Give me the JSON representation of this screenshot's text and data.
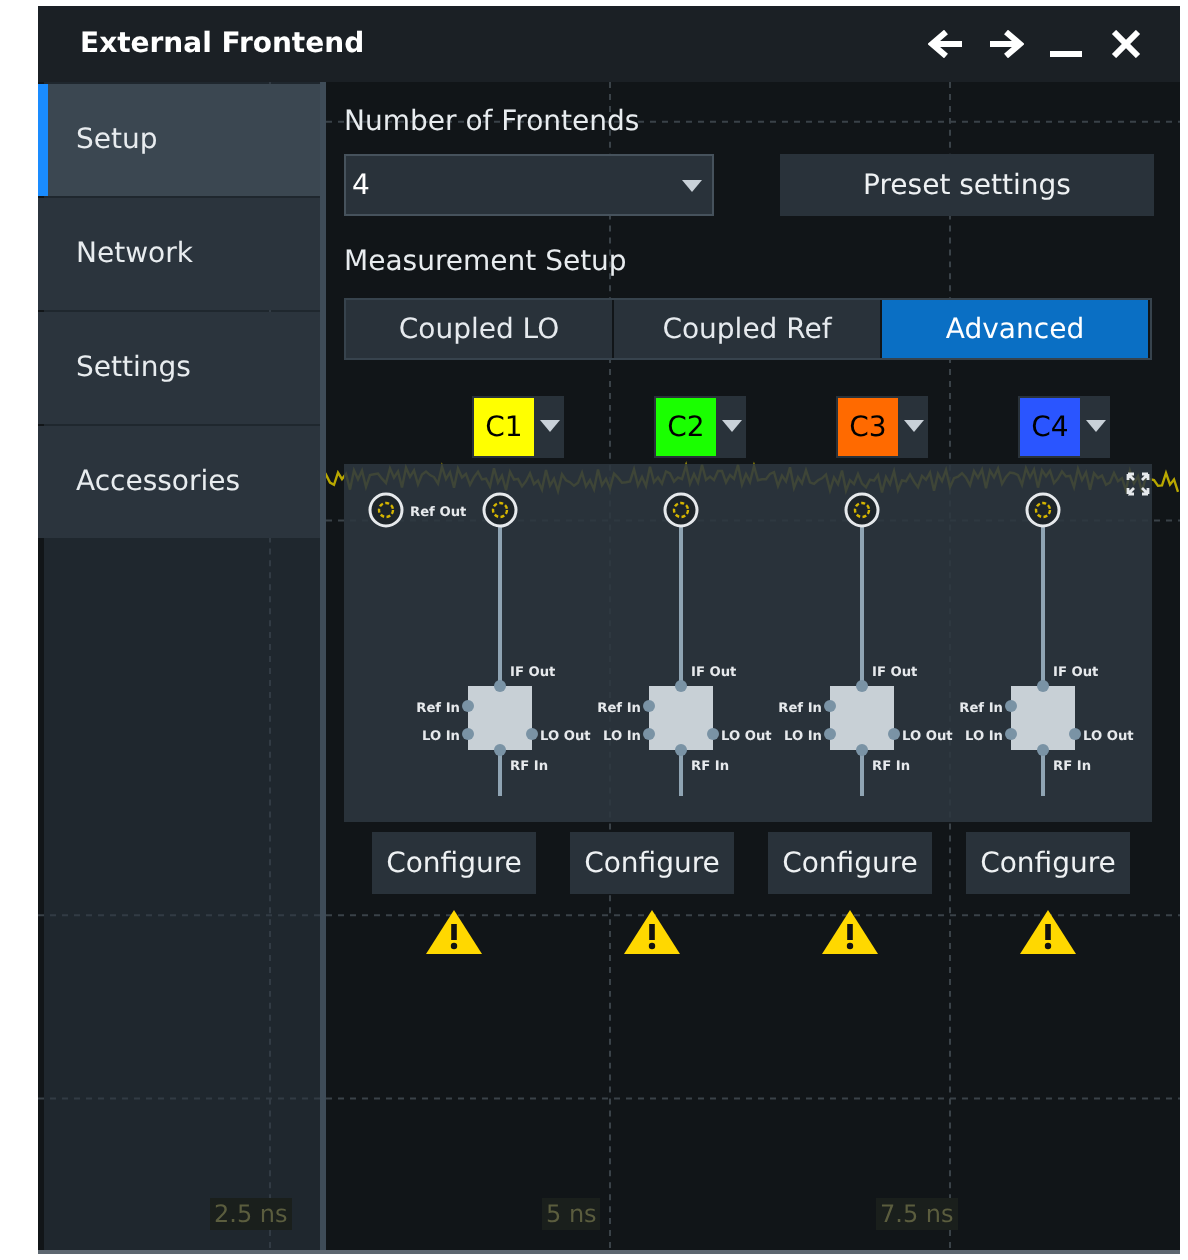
{
  "window": {
    "title": "External Frontend"
  },
  "sidebar": {
    "items": [
      {
        "label": "Setup",
        "selected": true
      },
      {
        "label": "Network",
        "selected": false
      },
      {
        "label": "Settings",
        "selected": false
      },
      {
        "label": "Accessories",
        "selected": false
      }
    ]
  },
  "frontends": {
    "label": "Number of Frontends",
    "value": "4"
  },
  "preset_button": "Preset settings",
  "measurement_setup": {
    "label": "Measurement Setup",
    "options": [
      {
        "label": "Coupled LO",
        "selected": false
      },
      {
        "label": "Coupled Ref",
        "selected": false
      },
      {
        "label": "Advanced",
        "selected": true
      }
    ]
  },
  "diagram": {
    "ref_out": "Ref Out"
  },
  "channels": [
    {
      "label": "C1",
      "color": "#ffff00",
      "if_out": "IF Out",
      "ref_in": "Ref In",
      "lo_in": "LO In",
      "lo_out": "LO Out",
      "rf_in": "RF In",
      "configure": "Configure",
      "warning": true
    },
    {
      "label": "C2",
      "color": "#1aff00",
      "if_out": "IF Out",
      "ref_in": "Ref In",
      "lo_in": "LO In",
      "lo_out": "LO Out",
      "rf_in": "RF In",
      "configure": "Configure",
      "warning": true
    },
    {
      "label": "C3",
      "color": "#ff6a00",
      "if_out": "IF Out",
      "ref_in": "Ref In",
      "lo_in": "LO In",
      "lo_out": "LO Out",
      "rf_in": "RF In",
      "configure": "Configure",
      "warning": true
    },
    {
      "label": "C4",
      "color": "#2a55ff",
      "if_out": "IF Out",
      "ref_in": "Ref In",
      "lo_in": "LO In",
      "lo_out": "LO Out",
      "rf_in": "RF In",
      "configure": "Configure",
      "warning": true
    }
  ],
  "time_axis": [
    "2.5 ns",
    "5 ns",
    "7.5 ns"
  ]
}
